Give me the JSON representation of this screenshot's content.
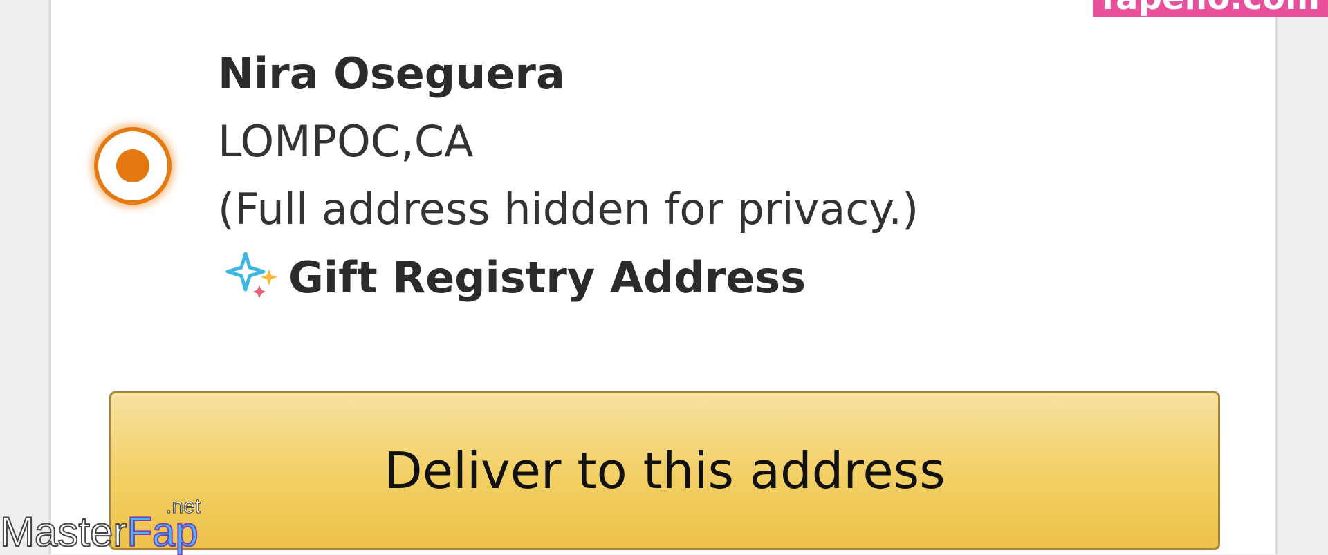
{
  "address": {
    "name": "Nira Oseguera",
    "city_state": "LOMPOC,CA",
    "privacy_note": "(Full address hidden for privacy.)",
    "gift_label": "Gift Registry Address",
    "gift_icon": "sparkle-icon",
    "selected": true
  },
  "deliver_button_label": "Deliver to this address",
  "watermarks": {
    "top_right": "fapello.com",
    "bottom_left_main": "Master",
    "bottom_left_accent": "Fap",
    "bottom_left_suffix": ".net"
  },
  "colors": {
    "radio_accent": "#e47911",
    "button_fill": "#f2cf63",
    "button_border": "#a88734",
    "text": "#2b2b2b"
  }
}
